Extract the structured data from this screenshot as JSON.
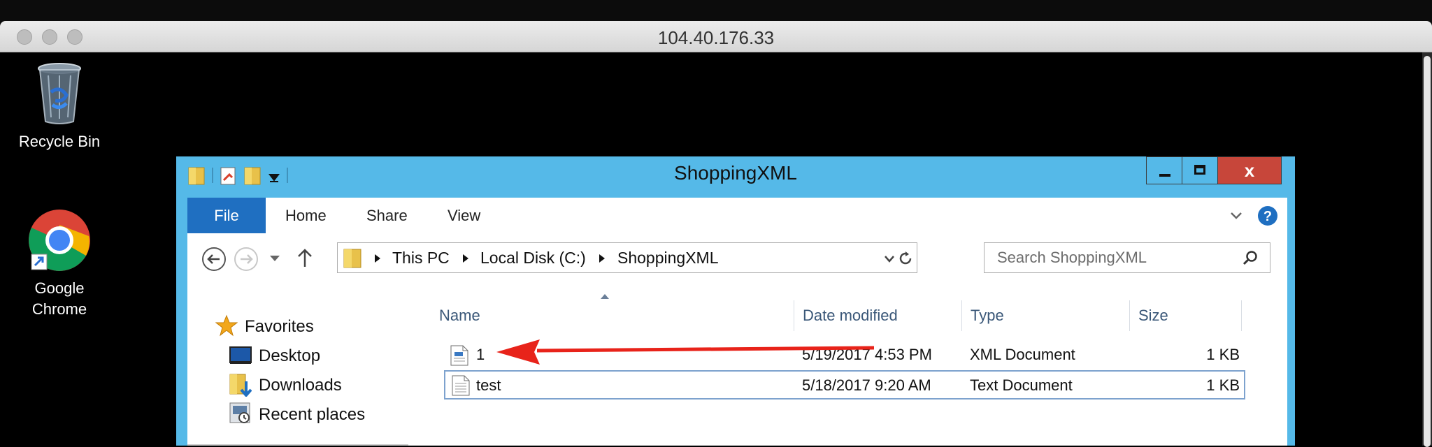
{
  "mac_window": {
    "title": "104.40.176.33"
  },
  "desktop_icons": [
    {
      "label": "Recycle Bin"
    },
    {
      "label": "Google Chrome"
    }
  ],
  "explorer": {
    "title": "ShoppingXML",
    "controls": {
      "minimize": "–",
      "maximize": "□",
      "close": "x"
    },
    "ribbon_tabs": [
      "File",
      "Home",
      "Share",
      "View"
    ],
    "breadcrumb": [
      "This PC",
      "Local Disk (C:)",
      "ShoppingXML"
    ],
    "search_placeholder": "Search ShoppingXML",
    "nav_pane": {
      "favorites": "Favorites",
      "items": [
        "Desktop",
        "Downloads",
        "Recent places"
      ]
    },
    "columns": [
      "Name",
      "Date modified",
      "Type",
      "Size"
    ],
    "files": [
      {
        "name": "1",
        "date": "5/19/2017 4:53 PM",
        "type": "XML Document",
        "size": "1 KB"
      },
      {
        "name": "test",
        "date": "5/18/2017 9:20 AM",
        "type": "Text Document",
        "size": "1 KB"
      }
    ]
  },
  "colors": {
    "titlebar": "#55b9e8",
    "file_tab": "#1f6fc1",
    "annotation_arrow": "#e8231a",
    "close_button": "#c7463a"
  }
}
